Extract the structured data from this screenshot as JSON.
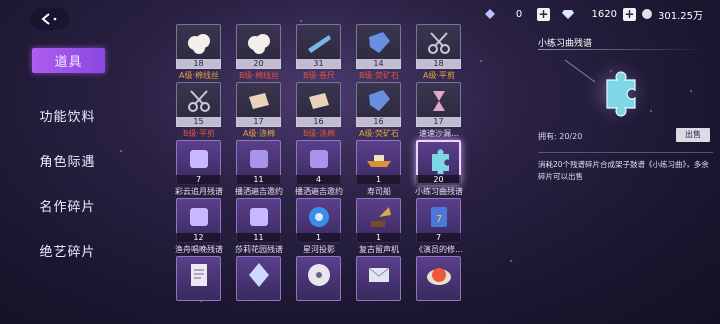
{
  "header": {
    "resources": [
      {
        "icon": "crystal-icon",
        "value": "0"
      },
      {
        "icon": "diamond-icon",
        "value": "1620"
      },
      {
        "icon": "coin-icon",
        "value": "301.25万"
      }
    ],
    "plus_label": "+"
  },
  "sidebar": {
    "items": [
      {
        "label": "道具",
        "active": true
      },
      {
        "label": "功能饮料"
      },
      {
        "label": "角色际遇"
      },
      {
        "label": "名作碎片"
      },
      {
        "label": "绝艺碎片"
      }
    ]
  },
  "inventory": {
    "rows": [
      [
        {
          "qty": "18",
          "name": "A级·棉线丝",
          "grade": "a",
          "icon": "cotton-icon"
        },
        {
          "qty": "20",
          "name": "B级·棉线丝",
          "grade": "b",
          "icon": "cotton-icon"
        },
        {
          "qty": "31",
          "name": "B级·卷尺",
          "grade": "b",
          "icon": "tape-measure-icon"
        },
        {
          "qty": "14",
          "name": "B级·荧矿石",
          "grade": "b",
          "icon": "ore-icon"
        },
        {
          "qty": "18",
          "name": "A级·平剪",
          "grade": "a",
          "icon": "scissors-icon"
        }
      ],
      [
        {
          "qty": "15",
          "name": "B级·平剪",
          "grade": "b",
          "icon": "scissors-icon"
        },
        {
          "qty": "17",
          "name": "A级·涤棉",
          "grade": "a",
          "icon": "fabric-icon"
        },
        {
          "qty": "16",
          "name": "B级·涤棉",
          "grade": "b",
          "icon": "fabric-icon"
        },
        {
          "qty": "16",
          "name": "A级·荧矿石",
          "grade": "a",
          "icon": "ore-icon"
        },
        {
          "qty": "17",
          "name": "速速沙漏…",
          "grade": "n",
          "icon": "hourglass-icon"
        }
      ],
      [
        {
          "qty": "7",
          "name": "彩云追月残谱",
          "grade": "n",
          "icon": "score-fragment-icon",
          "purple": true
        },
        {
          "qty": "11",
          "name": "播洒遍吉邀约",
          "grade": "n",
          "icon": "invitation-icon",
          "purple": true
        },
        {
          "qty": "4",
          "name": "播洒遍吉邀约",
          "grade": "n",
          "icon": "invitation-icon",
          "purple": true
        },
        {
          "qty": "1",
          "name": "寿司船",
          "grade": "n",
          "icon": "sushi-boat-icon",
          "purple": true
        },
        {
          "qty": "20",
          "name": "小练习曲残谱",
          "grade": "n",
          "icon": "puzzle-piece-icon",
          "purple": true,
          "selected": true
        }
      ],
      [
        {
          "qty": "12",
          "name": "渔舟唱晚残谱",
          "grade": "n",
          "icon": "score-fragment-icon",
          "purple": true
        },
        {
          "qty": "11",
          "name": "莎莉花园残谱",
          "grade": "n",
          "icon": "score-fragment-icon",
          "purple": true
        },
        {
          "qty": "1",
          "name": "星河投影",
          "grade": "n",
          "icon": "galaxy-projector-icon",
          "purple": true
        },
        {
          "qty": "1",
          "name": "复古留声机",
          "grade": "n",
          "icon": "gramophone-icon",
          "purple": true
        },
        {
          "qty": "7",
          "name": "《演员的修…",
          "grade": "n",
          "icon": "book-icon",
          "purple": true
        }
      ],
      [
        {
          "qty": "",
          "name": "",
          "grade": "n",
          "icon": "document-icon",
          "purple": true
        },
        {
          "qty": "",
          "name": "",
          "grade": "n",
          "icon": "crystal-icon",
          "purple": true
        },
        {
          "qty": "",
          "name": "",
          "grade": "n",
          "icon": "film-reel-icon",
          "purple": true
        },
        {
          "qty": "",
          "name": "",
          "grade": "n",
          "icon": "envelope-icon",
          "purple": true
        },
        {
          "qty": "",
          "name": "",
          "grade": "n",
          "icon": "food-plate-icon",
          "purple": true
        }
      ]
    ]
  },
  "detail": {
    "title": "小练习曲残谱",
    "art_icon": "puzzle-piece-icon",
    "owned": "拥有: 20/20",
    "sell_label": "出售",
    "description": "消耗20个残谱碎片合成架子鼓谱《小练习曲》，多余碎片可以出售"
  },
  "colors": {
    "accent": "#a855f7",
    "grade_a": "#e6a640",
    "grade_b": "#e0563e"
  }
}
